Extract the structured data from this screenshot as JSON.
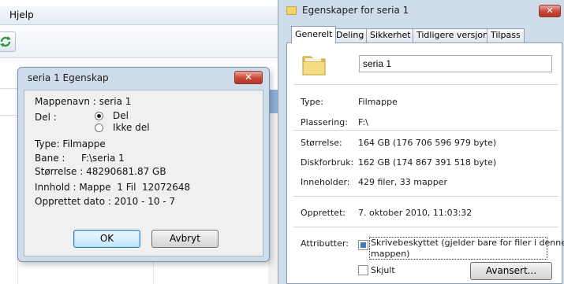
{
  "app": {
    "menu": {
      "help": "Hjelp"
    },
    "toolbar": {
      "refresh_icon": "refresh-icon"
    }
  },
  "dialog": {
    "title": "seria 1  Egenskap",
    "close_icon": "close-icon",
    "folder_name": "Mappenavn : seria 1",
    "share_label": "Del :",
    "share_options": [
      "Del",
      "Ikke del"
    ],
    "share_selected": "Del",
    "type": "Type: Filmappe",
    "path_label": "Bane :",
    "path_value": "F:\\seria 1",
    "size": "Størrelse : 48290681.87 GB",
    "contents": "Innhold : Mappe  1 Fil  12072648",
    "created": "Opprettet dato : 2010 - 10 - 7",
    "ok_label": "OK",
    "cancel_label": "Avbryt"
  },
  "properties": {
    "title": "Egenskaper for seria 1",
    "title_icon": "folder-icon",
    "close_icon": "close-icon",
    "tabs": [
      "Generelt",
      "Deling",
      "Sikkerhet",
      "Tidligere versjoner",
      "Tilpass"
    ],
    "active_tab": "Generelt",
    "name_value": "seria 1",
    "rows": [
      {
        "label": "Type:",
        "value": "Filmappe"
      },
      {
        "label": "Plassering:",
        "value": "F:\\"
      },
      {
        "label": "Størrelse:",
        "value": "164 GB (176 706 596 979 byte)"
      },
      {
        "label": "Diskforbruk:",
        "value": "162 GB (174 867 391 518 byte)"
      },
      {
        "label": "Inneholder:",
        "value": "429 filer, 33 mapper"
      }
    ],
    "created_label": "Opprettet:",
    "created_value": "7. oktober 2010, 11:03:32",
    "attributes_label": "Attributter:",
    "readonly_label_line1": "Skrivebeskyttet (gjelder bare for filer i denne",
    "readonly_label_line2": "mappen)",
    "readonly_state": "mixed",
    "hidden_label": "Skjult",
    "hidden_state": "unchecked",
    "advanced_label": "Avansert..."
  },
  "colors": {
    "window_frame": "#cfdcea",
    "close_button": "#c8463a",
    "checkbox_fill": "#3e7bc2"
  }
}
